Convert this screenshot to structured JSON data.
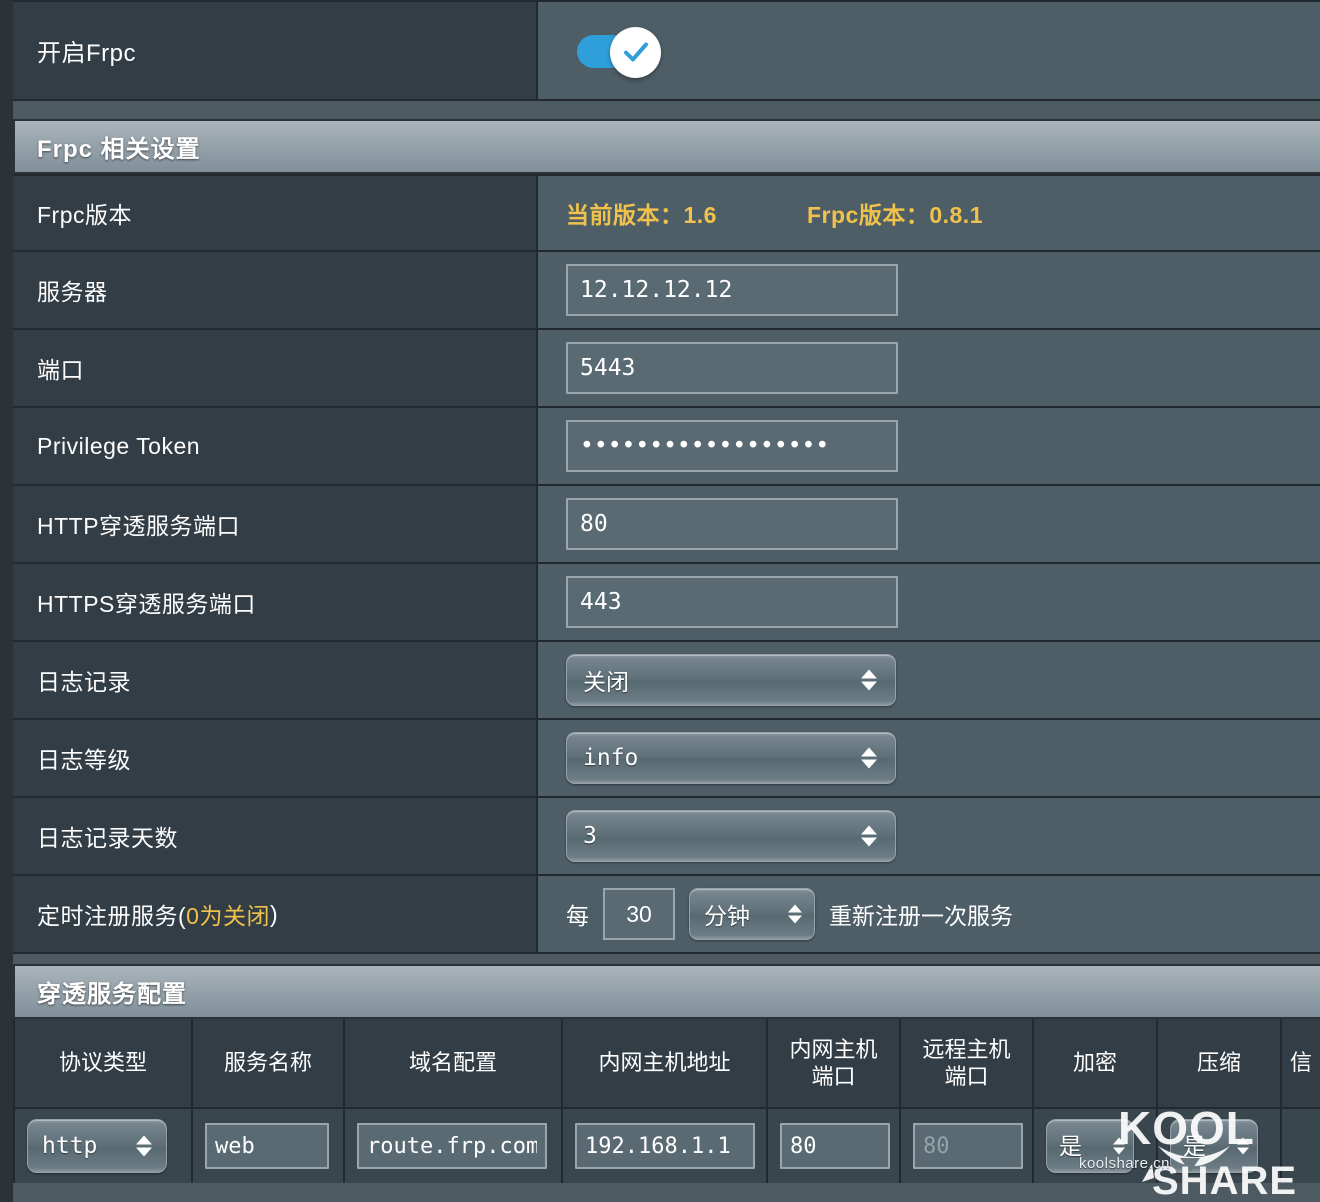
{
  "theme": {
    "page_bg": "#4e5a62",
    "label_bg": "#323d45",
    "value_bg": "#4e5e66",
    "accent_amber": "#f0c14b",
    "toggle_on": "#2f9fd9",
    "border": "#222a30"
  },
  "enable_row": {
    "label": "开启Frpc",
    "toggle_state": "on",
    "toggle_icon": "check-icon"
  },
  "frpc_section": {
    "title": "Frpc 相关设置",
    "rows": [
      {
        "label": "Frpc版本",
        "type": "version",
        "current_label": "当前版本：1.6",
        "frpc_label": "Frpc版本：0.8.1"
      },
      {
        "label": "服务器",
        "type": "text",
        "value": "12.12.12.12",
        "placeholder": ""
      },
      {
        "label": "端口",
        "type": "text",
        "value": "5443",
        "placeholder": ""
      },
      {
        "label": "Privilege Token",
        "type": "password",
        "value": "••••••••••••••••••",
        "placeholder": ""
      },
      {
        "label": "HTTP穿透服务端口",
        "type": "text",
        "value": "80",
        "placeholder": ""
      },
      {
        "label": "HTTPS穿透服务端口",
        "type": "text",
        "value": "443",
        "placeholder": ""
      },
      {
        "label": "日志记录",
        "type": "select",
        "value": "关闭",
        "cjk": true
      },
      {
        "label": "日志等级",
        "type": "select",
        "value": "info",
        "cjk": false
      },
      {
        "label": "日志记录天数",
        "type": "select",
        "value": "3",
        "cjk": false
      }
    ],
    "timer_row": {
      "label_main": "定时注册服务(",
      "label_accent": "0为关闭",
      "label_tail": ")",
      "prefix": "每",
      "interval_value": "30",
      "unit": "分钟",
      "suffix": "重新注册一次服务"
    }
  },
  "service_section": {
    "title": "穿透服务配置",
    "headers": [
      {
        "line1": "协议类型",
        "line2": ""
      },
      {
        "line1": "服务名称",
        "line2": ""
      },
      {
        "line1": "域名配置",
        "line2": ""
      },
      {
        "line1": "内网主机地址",
        "line2": ""
      },
      {
        "line1": "内网主机",
        "line2": "端口"
      },
      {
        "line1": "远程主机",
        "line2": "端口"
      },
      {
        "line1": "加密",
        "line2": ""
      },
      {
        "line1": "压缩",
        "line2": ""
      },
      {
        "line1": "信",
        "line2": ""
      }
    ],
    "rows": [
      {
        "protocol": "http",
        "service_name": "web",
        "domain": "route.frp.com",
        "local_ip": "192.168.1.1",
        "local_port": "80",
        "remote_port_placeholder": "80",
        "remote_port_value": "",
        "encrypt": "是",
        "compress": "是"
      }
    ]
  },
  "watermark": {
    "brand_top": "KOOL",
    "brand_bottom": "SHARE",
    "url": "koolshare.cn"
  }
}
